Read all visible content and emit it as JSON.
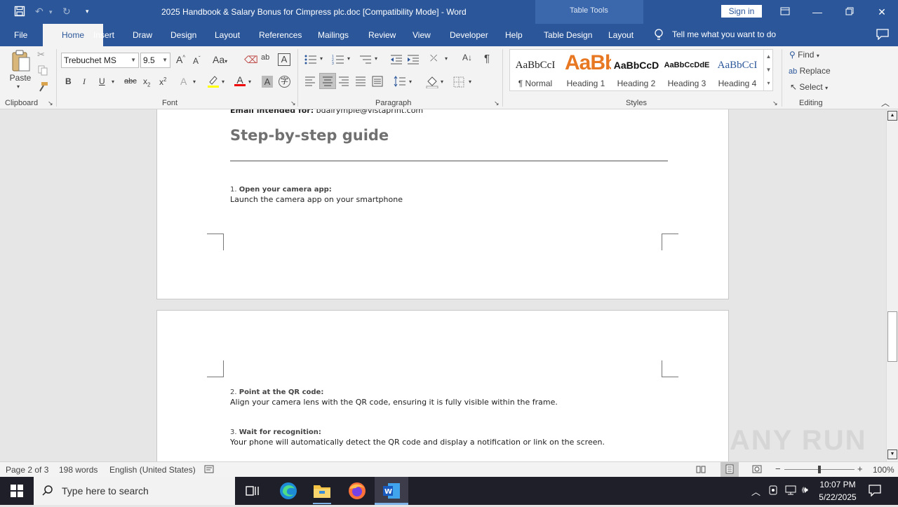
{
  "titlebar": {
    "doc_title": "2025 Handbook & Salary Bonus for Cimpress plc.doc [Compatibility Mode]  -  Word",
    "table_tools": "Table Tools",
    "signin": "Sign in"
  },
  "tabs": {
    "file": "File",
    "home": "Home",
    "insert": "Insert",
    "draw": "Draw",
    "design": "Design",
    "layout": "Layout",
    "references": "References",
    "mailings": "Mailings",
    "review": "Review",
    "view": "View",
    "developer": "Developer",
    "help": "Help",
    "table_design": "Table Design",
    "table_layout": "Layout",
    "tell_me": "Tell me what you want to do"
  },
  "ribbon": {
    "clipboard": {
      "paste": "Paste",
      "label": "Clipboard"
    },
    "font": {
      "name": "Trebuchet MS",
      "size": "9.5",
      "label": "Font",
      "case": "Aa"
    },
    "paragraph": {
      "label": "Paragraph"
    },
    "styles": {
      "label": "Styles",
      "items": [
        {
          "preview": "AaBbCcI",
          "name": "¶ Normal"
        },
        {
          "preview": "AaBbC",
          "name": "Heading 1"
        },
        {
          "preview": "AaBbCcD",
          "name": "Heading 2"
        },
        {
          "preview": "AaBbCcDdE",
          "name": "Heading 3"
        },
        {
          "preview": "AaBbCcI",
          "name": "Heading 4"
        }
      ]
    },
    "editing": {
      "label": "Editing",
      "find": "Find",
      "replace": "Replace",
      "select": "Select"
    }
  },
  "document": {
    "email_line_label": "Email intended for:",
    "email_line_value": "bdalrymple@vistaprint.com",
    "heading": "Step-by-step guide",
    "steps": [
      {
        "number": "1.",
        "title": "Open your camera app:",
        "text": "Launch the camera app on your smartphone"
      },
      {
        "number": "2.",
        "title": "Point at the QR code:",
        "text": "Align your camera lens with the QR code, ensuring it is fully visible within the frame."
      },
      {
        "number": "3.",
        "title": "Wait for recognition:",
        "text": "Your phone will automatically detect the QR code and display a notification or link on the screen."
      }
    ]
  },
  "status": {
    "page": "Page 2 of 3",
    "words": "198 words",
    "language": "English (United States)",
    "zoom": "100%"
  },
  "watermark": "ANY RUN",
  "taskbar": {
    "search_placeholder": "Type here to search",
    "time": "10:07 PM",
    "date": "5/22/2025"
  },
  "colors": {
    "word_blue": "#2b579a",
    "heading_gray": "#707070",
    "taskbar": "#1f1f2a"
  }
}
